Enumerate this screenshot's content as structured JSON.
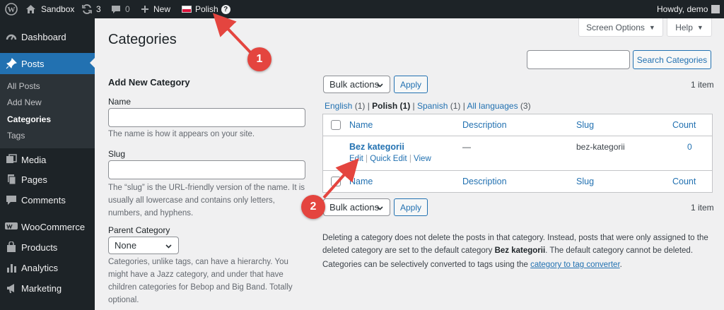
{
  "adminbar": {
    "site_name": "Sandbox",
    "updates_count": "3",
    "comments_count": "0",
    "new_label": "New",
    "language_label": "Polish",
    "help_glyph": "?",
    "greeting": "Howdy, demo",
    "icons": [
      "wordpress-logo-icon",
      "home-icon",
      "updates-icon",
      "comment-icon",
      "plus-icon",
      "polish-flag-icon",
      "question-icon",
      "avatar-icon"
    ]
  },
  "sidebar": {
    "items": [
      {
        "label": "Dashboard",
        "icon": "dashboard-icon"
      },
      {
        "label": "Posts",
        "icon": "pin-icon"
      },
      {
        "label": "Media",
        "icon": "media-icon"
      },
      {
        "label": "Pages",
        "icon": "pages-icon"
      },
      {
        "label": "Comments",
        "icon": "comments-icon"
      },
      {
        "label": "WooCommerce",
        "icon": "woocommerce-icon"
      },
      {
        "label": "Products",
        "icon": "products-icon"
      },
      {
        "label": "Analytics",
        "icon": "analytics-icon"
      },
      {
        "label": "Marketing",
        "icon": "marketing-icon"
      }
    ],
    "submenu": [
      "All Posts",
      "Add New",
      "Categories",
      "Tags"
    ]
  },
  "screen_options_label": "Screen Options",
  "help_label": "Help",
  "page_title": "Categories",
  "search_button": "Search Categories",
  "form": {
    "title": "Add New Category",
    "name_label": "Name",
    "name_desc": "The name is how it appears on your site.",
    "slug_label": "Slug",
    "slug_desc": "The “slug” is the URL-friendly version of the name. It is usually all lowercase and contains only letters, numbers, and hyphens.",
    "parent_label": "Parent Category",
    "parent_value": "None",
    "parent_desc": "Categories, unlike tags, can have a hierarchy. You might have a Jazz category, and under that have children categories for Bebop and Big Band. Totally optional."
  },
  "bulk": {
    "select_label": "Bulk actions",
    "apply_label": "Apply",
    "count_text": "1 item"
  },
  "language_filter": [
    {
      "label": "English",
      "count": "(1)"
    },
    {
      "label": "Polish",
      "count": "(1)"
    },
    {
      "label": "Spanish",
      "count": "(1)"
    },
    {
      "label": "All languages",
      "count": "(3)"
    }
  ],
  "table": {
    "columns": [
      "Name",
      "Description",
      "Slug",
      "Count"
    ],
    "rows": [
      {
        "name": "Bez kategorii",
        "description": "—",
        "slug": "bez-kategorii",
        "count": "0"
      }
    ],
    "row_actions": [
      "Edit",
      "Quick Edit",
      "View"
    ]
  },
  "notes": {
    "delete_prefix": "Deleting a category does not delete the posts in that category. Instead, posts that were only assigned to the deleted category are set to the default category ",
    "delete_bold": "Bez kategorii",
    "delete_suffix": ". The default category cannot be deleted.",
    "convert_prefix": "Categories can be selectively converted to tags using the ",
    "convert_link": "category to tag converter",
    "convert_suffix": "."
  },
  "annotations": {
    "badge_1": "1",
    "badge_2": "2",
    "color": "#e4453f"
  },
  "colors": {
    "accent": "#2271b1",
    "menu_bg": "#1d2327",
    "annotation": "#e4453f"
  }
}
